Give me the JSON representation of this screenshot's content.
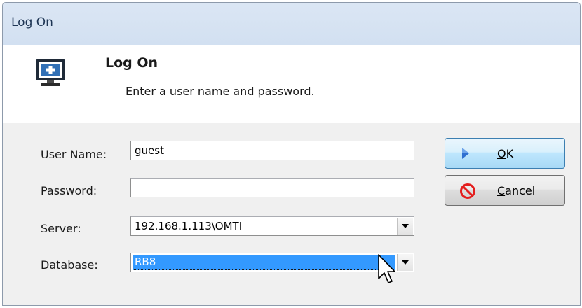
{
  "window": {
    "title": "Log On"
  },
  "header": {
    "title": "Log On",
    "subtitle": "Enter a user name and password.",
    "icon": "monitor-plus-icon"
  },
  "form": {
    "username": {
      "label": "User Name:",
      "value": "guest"
    },
    "password": {
      "label": "Password:",
      "value": ""
    },
    "server": {
      "label": "Server:",
      "value": "192.168.1.113\\OMTI"
    },
    "database": {
      "label": "Database:",
      "value": "RB8"
    }
  },
  "buttons": {
    "ok": {
      "label": "OK",
      "icon": "play-arrow-icon"
    },
    "cancel": {
      "label": "Cancel",
      "icon": "no-entry-icon"
    }
  },
  "colors": {
    "title_bar": "#d6e3f3",
    "selection": "#3399ff",
    "cancel_icon": "#e41e1e"
  }
}
